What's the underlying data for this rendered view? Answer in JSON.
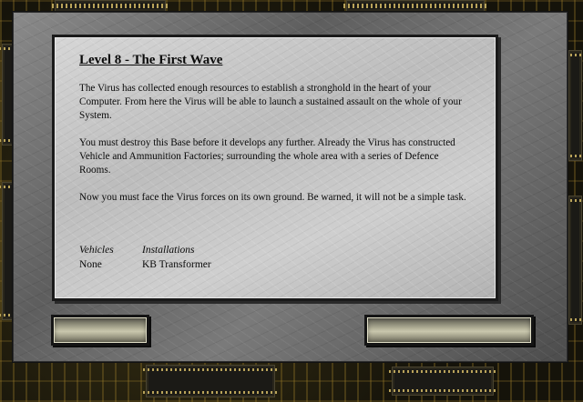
{
  "briefing": {
    "title": "Level 8 - The First Wave",
    "paragraphs": [
      "The Virus has collected enough resources to establish a stronghold in the heart of your Computer. From here the Virus will be able to launch a sustained assault on the whole of your System.",
      "You must destroy this Base before it develops any further. Already the Virus has constructed Vehicle and Ammunition Factories; surrounding the whole area with a series of Defence Rooms.",
      "Now you must face the Virus forces on its own ground. Be warned, it will not be a simple task."
    ],
    "vehicles_label": "Vehicles",
    "vehicles_value": "None",
    "installations_label": "Installations",
    "installations_value": "KB Transformer"
  },
  "buttons": {
    "left_label": "",
    "right_label": ""
  }
}
